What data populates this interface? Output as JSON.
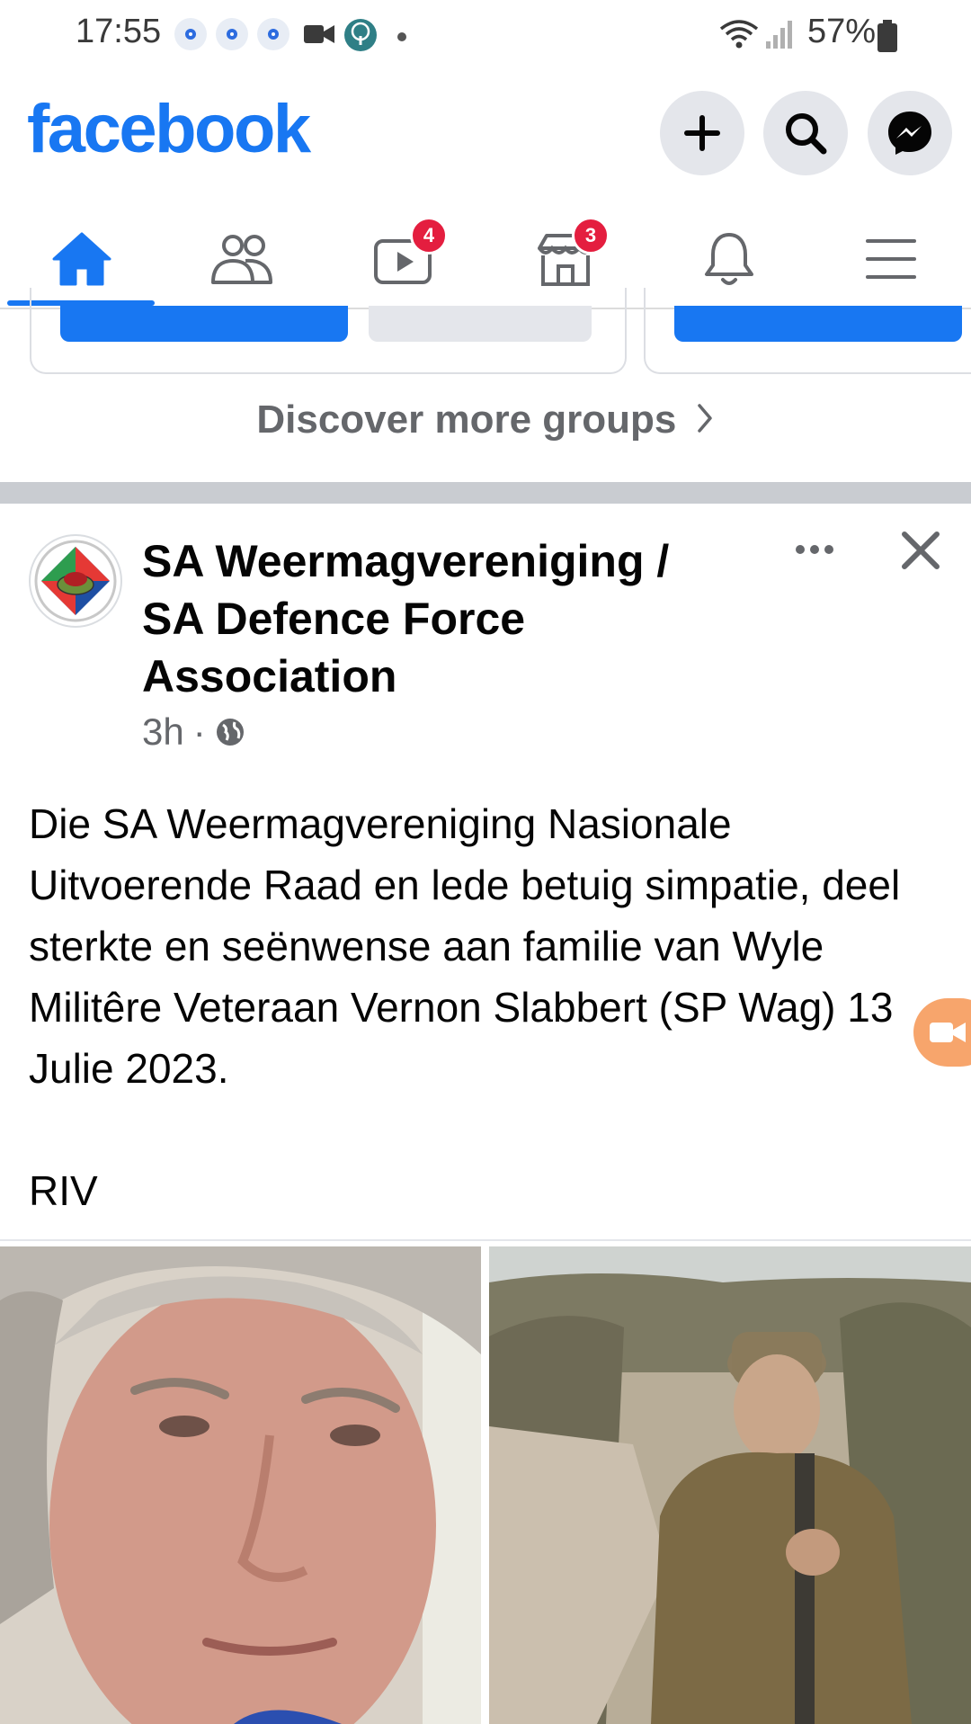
{
  "status_bar": {
    "time": "17:55",
    "battery": "57%",
    "icons": [
      "notification-dot-icon",
      "notification-dot-icon",
      "notification-dot-icon",
      "video-call-icon",
      "tree-app-icon",
      "more-dot-icon",
      "wifi-icon",
      "signal-icon",
      "battery-icon"
    ]
  },
  "header": {
    "logo": "facebook",
    "buttons": [
      "plus-icon",
      "search-icon",
      "messenger-icon"
    ]
  },
  "nav": {
    "tabs": [
      {
        "name": "home",
        "active": true
      },
      {
        "name": "friends"
      },
      {
        "name": "video",
        "badge": "4"
      },
      {
        "name": "marketplace",
        "badge": "3"
      },
      {
        "name": "notifications"
      },
      {
        "name": "menu"
      }
    ]
  },
  "groups_section": {
    "discover_label": "Discover more groups"
  },
  "post": {
    "page_name": "SA Weermagvereniging / SA Defence Force Association",
    "time": "3h",
    "separator": "·",
    "text": "Die SA Weermagvereniging Nasionale Uitvoerende Raad en lede betuig simpatie, deel sterkte en seënwense aan familie van Wyle Militêre Veteraan Vernon Slabbert (SP Wag) 13 Julie 2023.\n\nRIV"
  },
  "colors": {
    "brand": "#1877f2",
    "badge": "#e41e3f",
    "secondary_text": "#65676b",
    "divider": "#c9ccd1"
  }
}
